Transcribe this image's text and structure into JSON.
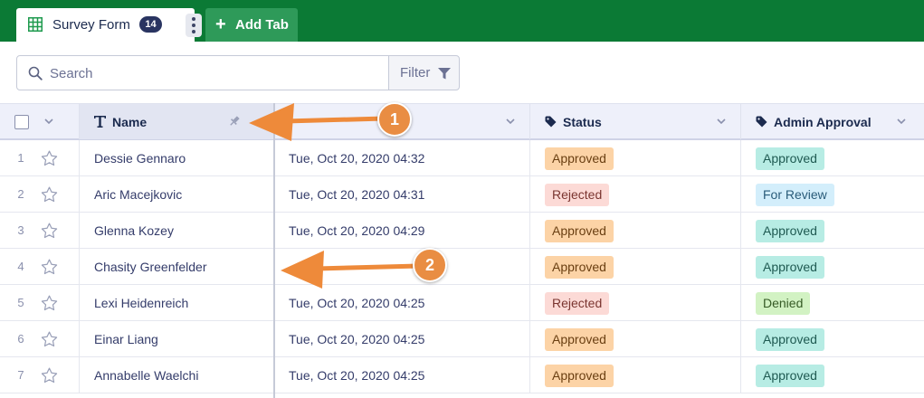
{
  "tabs": {
    "active": {
      "label": "Survey Form",
      "count": "14"
    },
    "add_label": "Add Tab"
  },
  "toolbar": {
    "search_placeholder": "Search",
    "filter_label": "Filter"
  },
  "columns": {
    "name": "Name",
    "status": "Status",
    "admin_approval": "Admin Approval"
  },
  "rows": [
    {
      "num": "1",
      "name": "Dessie Gennaro",
      "date": "Tue, Oct 20, 2020 04:32",
      "status": "Approved",
      "approval": "Approved"
    },
    {
      "num": "2",
      "name": "Aric Macejkovic",
      "date": "Tue, Oct 20, 2020 04:31",
      "status": "Rejected",
      "approval": "For Review"
    },
    {
      "num": "3",
      "name": "Glenna Kozey",
      "date": "Tue, Oct 20, 2020 04:29",
      "status": "Approved",
      "approval": "Approved"
    },
    {
      "num": "4",
      "name": "Chasity Greenfelder",
      "date": "",
      "status": "Approved",
      "approval": "Approved"
    },
    {
      "num": "5",
      "name": "Lexi Heidenreich",
      "date": "Tue, Oct 20, 2020 04:25",
      "status": "Rejected",
      "approval": "Denied"
    },
    {
      "num": "6",
      "name": "Einar Liang",
      "date": "Tue, Oct 20, 2020 04:25",
      "status": "Approved",
      "approval": "Approved"
    },
    {
      "num": "7",
      "name": "Annabelle Waelchi",
      "date": "Tue, Oct 20, 2020 04:25",
      "status": "Approved",
      "approval": "Approved"
    }
  ],
  "badge_colors": {
    "status": {
      "Approved": {
        "bg": "#fcd3a6",
        "fg": "#6a3f12"
      },
      "Rejected": {
        "bg": "#fcdad6",
        "fg": "#7a3530"
      }
    },
    "approval": {
      "Approved": {
        "bg": "#b7ece4",
        "fg": "#1f5a52"
      },
      "For Review": {
        "bg": "#d3eefb",
        "fg": "#2a5c7a"
      },
      "Denied": {
        "bg": "#d2f2c3",
        "fg": "#355a25"
      }
    }
  },
  "annotations": [
    {
      "label": "1"
    },
    {
      "label": "2"
    }
  ],
  "colors": {
    "topbar": "#0b7a35",
    "add_tab": "#2e9a59",
    "arrow": "#ee8a3a"
  }
}
